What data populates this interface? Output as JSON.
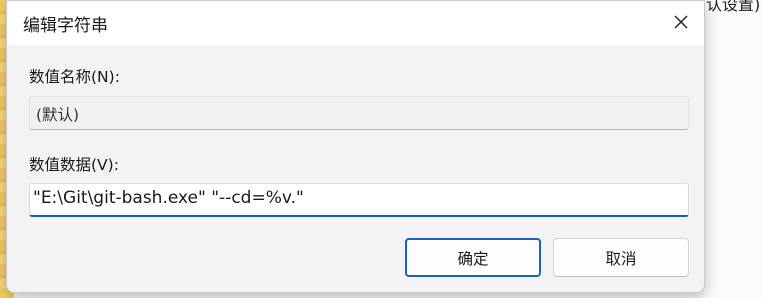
{
  "background": {
    "top_text": "编辑字符串",
    "right_text": "认设置)"
  },
  "dialog": {
    "title": "编辑字符串",
    "close_icon": "close-icon",
    "value_name_label": "数值名称(N):",
    "value_name": "(默认)",
    "value_data_label": "数值数据(V):",
    "value_data": "\"E:\\Git\\git-bash.exe\" \"--cd=%v.\"",
    "ok_label": "确定",
    "cancel_label": "取消"
  },
  "colors": {
    "accent": "#0a64c7",
    "ok_border": "#1e61b8"
  }
}
